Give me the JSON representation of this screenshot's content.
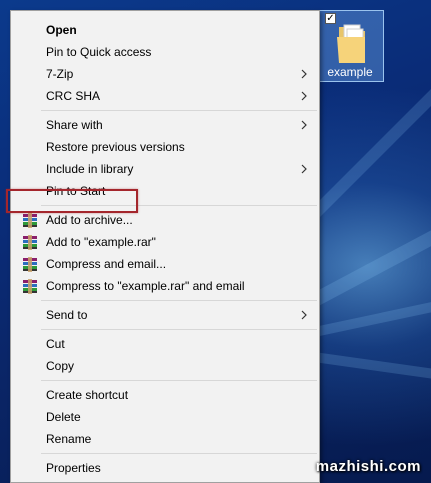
{
  "desktop": {
    "icon_label": "example",
    "icon_checked": true
  },
  "menu": {
    "items": [
      {
        "label": "Open",
        "bold": true
      },
      {
        "label": "Pin to Quick access"
      },
      {
        "label": "7-Zip",
        "submenu": true
      },
      {
        "label": "CRC SHA",
        "submenu": true
      },
      {
        "label": "Share with",
        "submenu": true
      },
      {
        "label": "Restore previous versions"
      },
      {
        "label": "Include in library",
        "submenu": true
      },
      {
        "label": "Pin to Start"
      },
      {
        "label": "Add to archive...",
        "icon": "winrar-icon",
        "highlighted": true
      },
      {
        "label": "Add to \"example.rar\"",
        "icon": "winrar-icon"
      },
      {
        "label": "Compress and email...",
        "icon": "winrar-icon"
      },
      {
        "label": "Compress to \"example.rar\" and email",
        "icon": "winrar-icon"
      },
      {
        "label": "Send to",
        "submenu": true
      },
      {
        "label": "Cut"
      },
      {
        "label": "Copy"
      },
      {
        "label": "Create shortcut"
      },
      {
        "label": "Delete"
      },
      {
        "label": "Rename"
      },
      {
        "label": "Properties"
      }
    ]
  },
  "watermark": "mazhishi.com",
  "colors": {
    "highlight_border": "#a4262c",
    "menu_background": "#f2f2f2"
  }
}
